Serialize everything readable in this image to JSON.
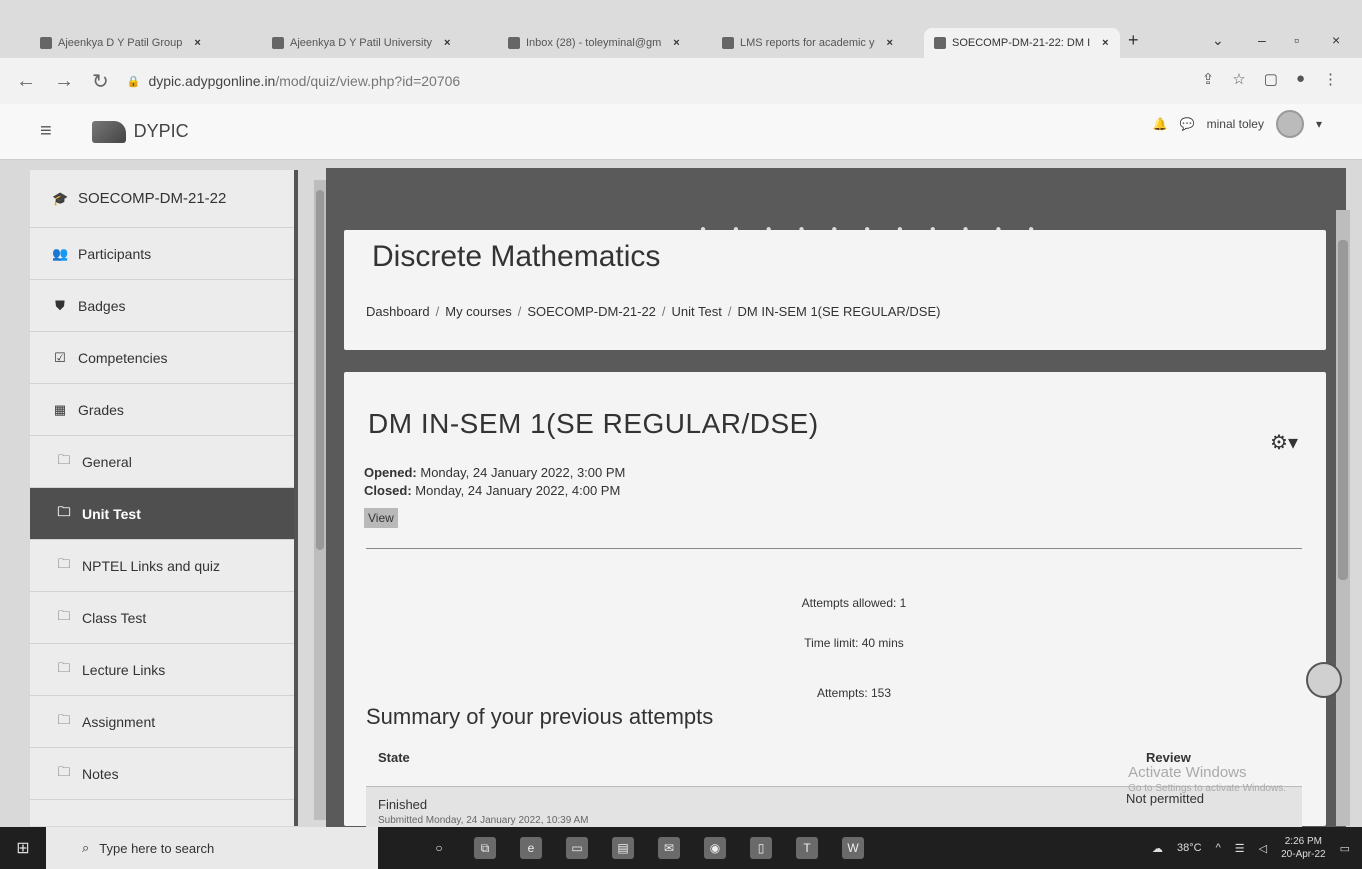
{
  "browser": {
    "tabs": [
      {
        "label": "Ajeenkya D Y Patil Group",
        "active": false
      },
      {
        "label": "Ajeenkya D Y Patil University",
        "active": false
      },
      {
        "label": "Inbox (28) - toleyminal@gm",
        "active": false
      },
      {
        "label": "LMS reports for academic y",
        "active": false
      },
      {
        "label": "SOECOMP-DM-21-22: DM I",
        "active": true
      }
    ],
    "new_tab_label": "+",
    "url_domain": "dypic.adypgonline.in",
    "url_path": "/mod/quiz/view.php?id=20706"
  },
  "topnav": {
    "brand": "DYPIC",
    "user_name": "minal toley"
  },
  "drawer": {
    "course": "SOECOMP-DM-21-22",
    "items": [
      {
        "label": "Participants",
        "icon": "users-icon"
      },
      {
        "label": "Badges",
        "icon": "shield-icon"
      },
      {
        "label": "Competencies",
        "icon": "checkbox-icon"
      },
      {
        "label": "Grades",
        "icon": "table-icon"
      },
      {
        "label": "General",
        "icon": "folder-icon"
      },
      {
        "label": "Unit Test",
        "icon": "folder-icon",
        "active": true
      },
      {
        "label": "NPTEL Links and quiz",
        "icon": "folder-icon"
      },
      {
        "label": "Class Test",
        "icon": "folder-icon"
      },
      {
        "label": "Lecture Links",
        "icon": "folder-icon"
      },
      {
        "label": "Assignment",
        "icon": "folder-icon"
      },
      {
        "label": "Notes",
        "icon": "folder-icon"
      }
    ]
  },
  "header": {
    "course_title": "Discrete Mathematics",
    "breadcrumb": [
      "Dashboard",
      "My courses",
      "SOECOMP-DM-21-22",
      "Unit Test",
      "DM IN-SEM 1(SE REGULAR/DSE)"
    ],
    "breadcrumb_sep": "/"
  },
  "quiz": {
    "title": "DM IN-SEM 1(SE REGULAR/DSE)",
    "opened_label": "Opened:",
    "opened_value": "Monday, 24 January 2022, 3:00 PM",
    "closed_label": "Closed:",
    "closed_value": "Monday, 24 January 2022, 4:00 PM",
    "view_button": "View",
    "attempts_allowed": "Attempts allowed: 1",
    "time_limit": "Time limit: 40 mins",
    "attempts": "Attempts: 153",
    "summary_title": "Summary of your previous attempts",
    "table": {
      "headers": [
        "State",
        "Review"
      ],
      "rows": [
        {
          "state": "Finished",
          "submitted": "Submitted Monday, 24 January 2022, 10:39 AM",
          "review": "Not permitted"
        }
      ]
    }
  },
  "watermark": {
    "title": "Activate Windows",
    "subtitle": "Go to Settings to activate Windows."
  },
  "taskbar": {
    "search_placeholder": "Type here to search",
    "temperature": "38°C",
    "time": "2:26 PM",
    "date": "20-Apr-22"
  }
}
